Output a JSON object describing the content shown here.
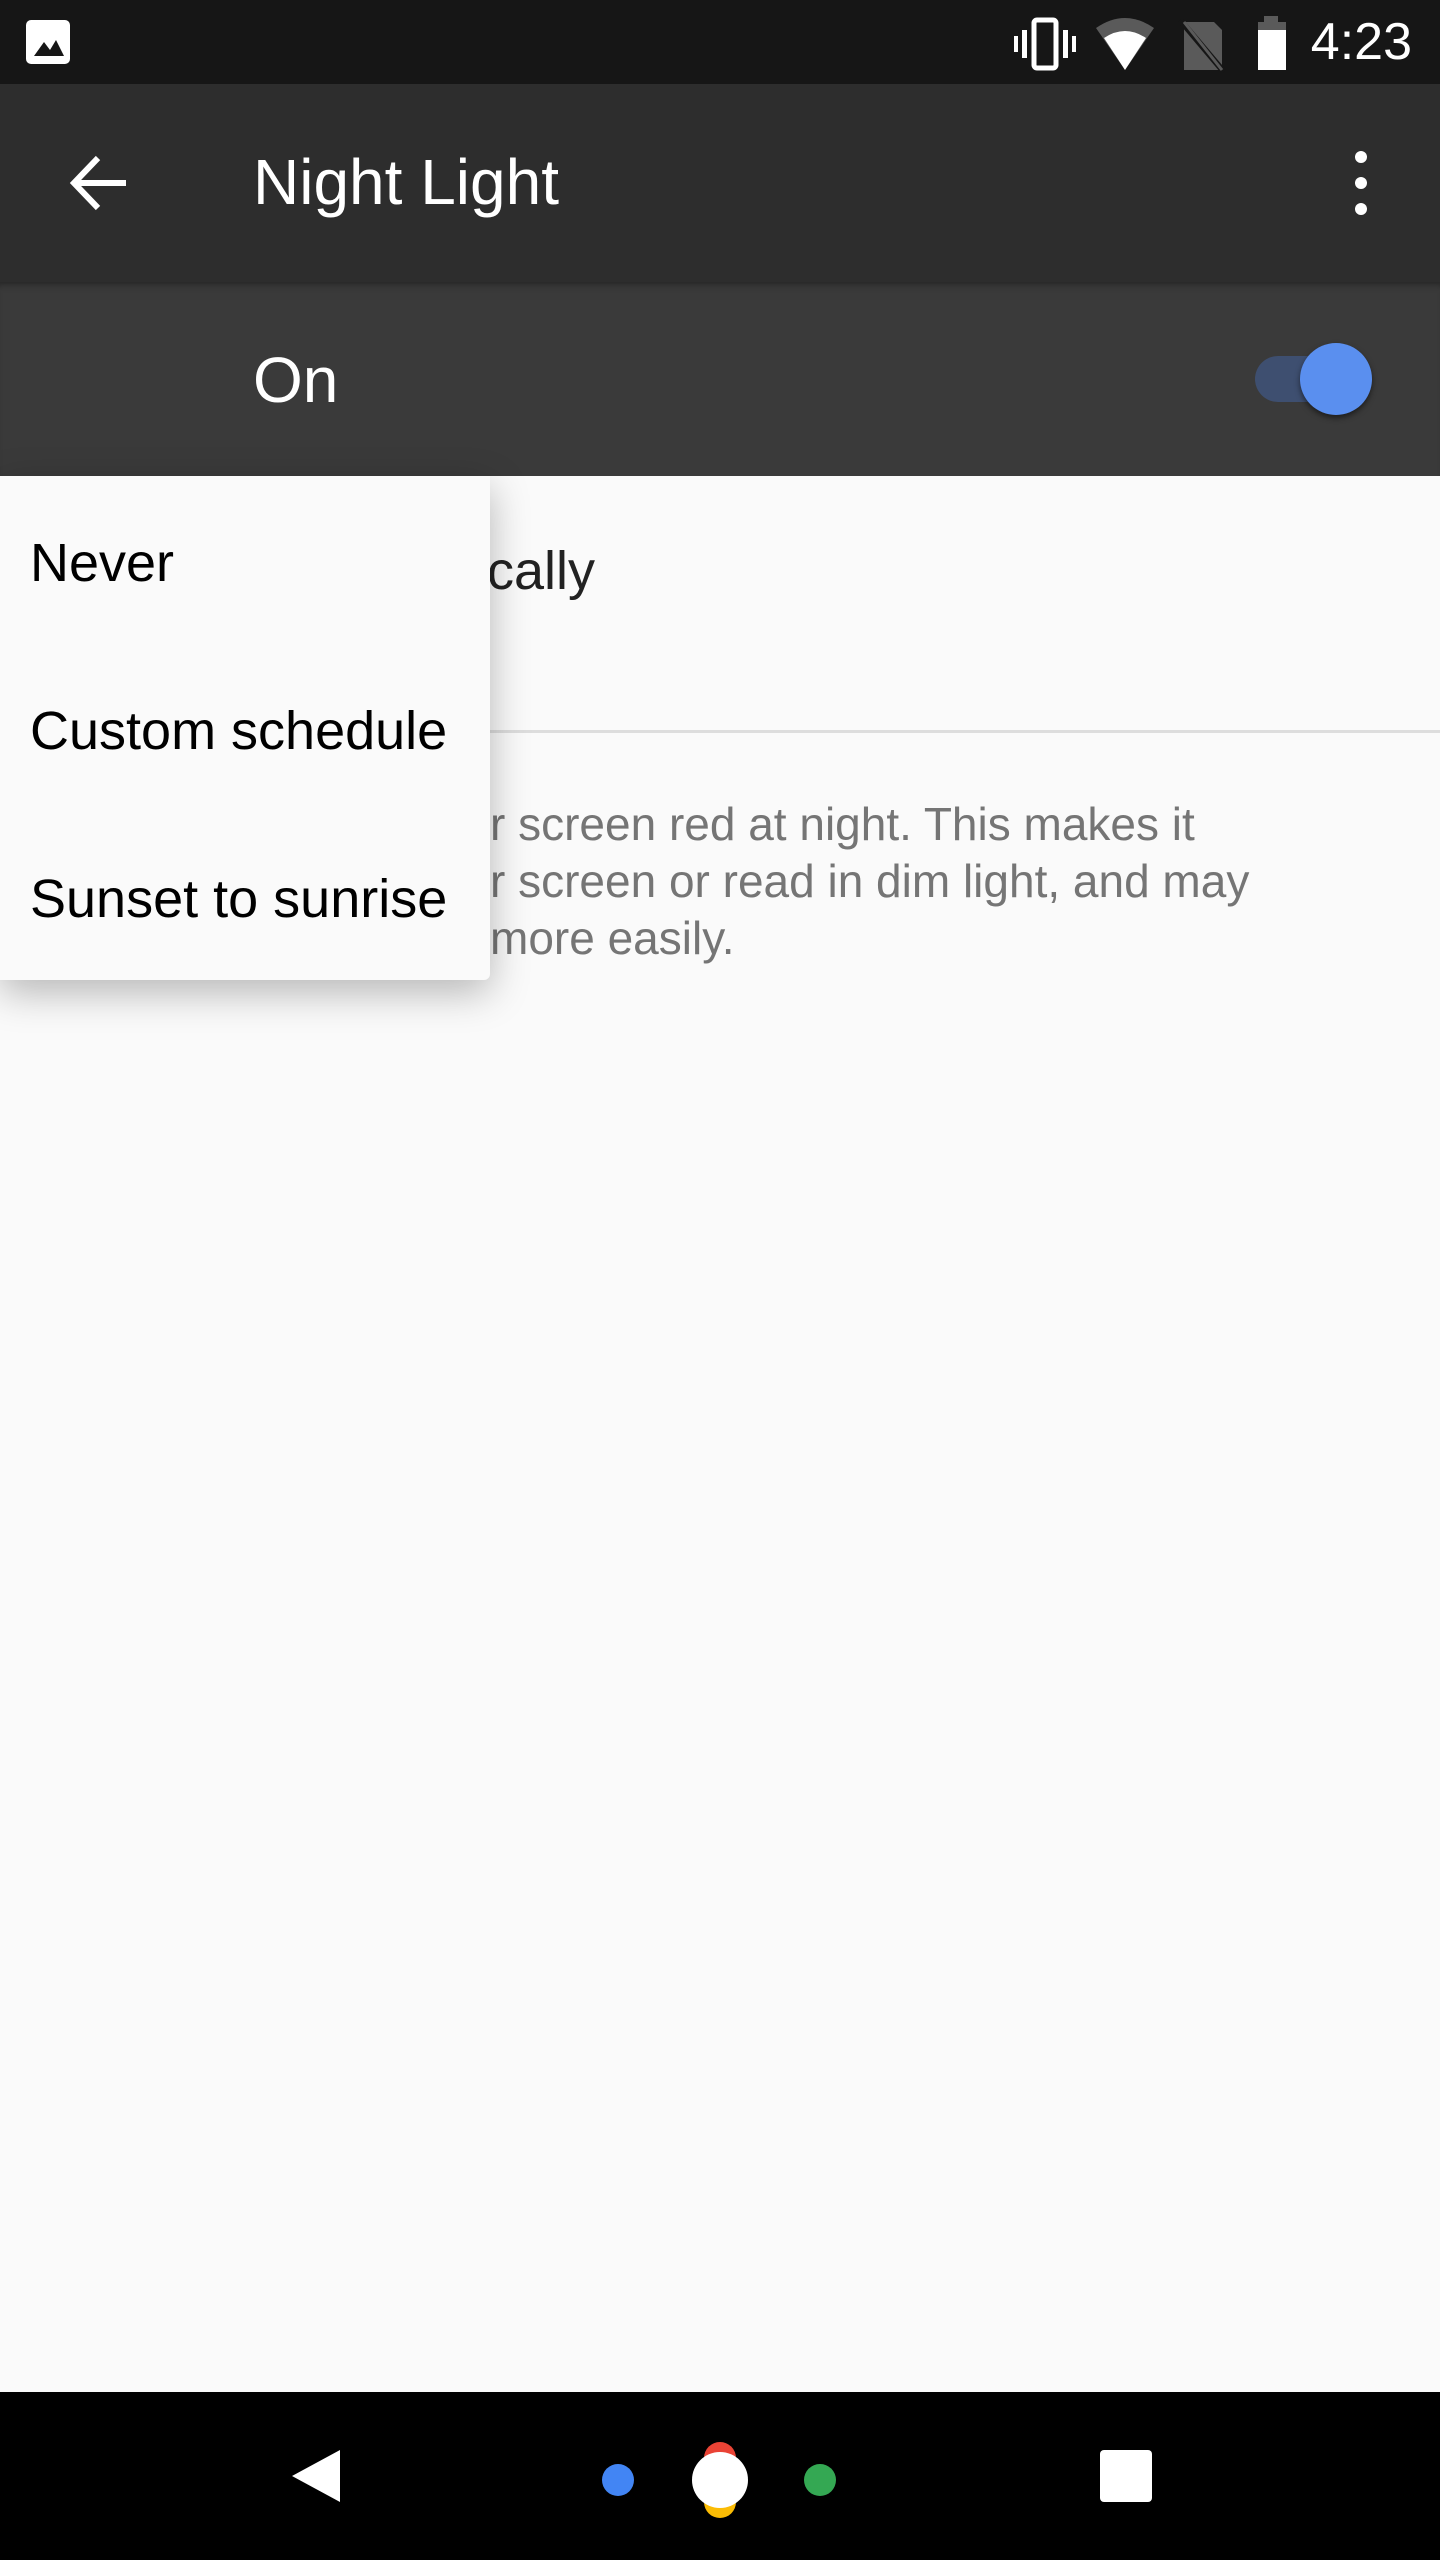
{
  "status_bar": {
    "time": "4:23",
    "icons": [
      "image-notification-icon",
      "vibrate-icon",
      "wifi-icon",
      "no-sim-icon",
      "battery-icon"
    ]
  },
  "toolbar": {
    "title": "Night Light",
    "back_icon": "arrow-back-icon",
    "more_icon": "more-vert-icon"
  },
  "master_switch": {
    "label": "On",
    "checked": true,
    "accent": "#5a8fef"
  },
  "settings": {
    "auto_fragment": "cally",
    "description_lines": [
      "r screen red at night. This makes it",
      "r screen or read in dim light, and may",
      "more easily."
    ]
  },
  "dropdown_menu": {
    "items": [
      "Never",
      "Custom schedule",
      "Sunset to sunrise"
    ]
  },
  "nav_bar": {
    "icons": [
      "back-triangle-icon",
      "assistant-home-icon",
      "recents-square-icon"
    ]
  }
}
